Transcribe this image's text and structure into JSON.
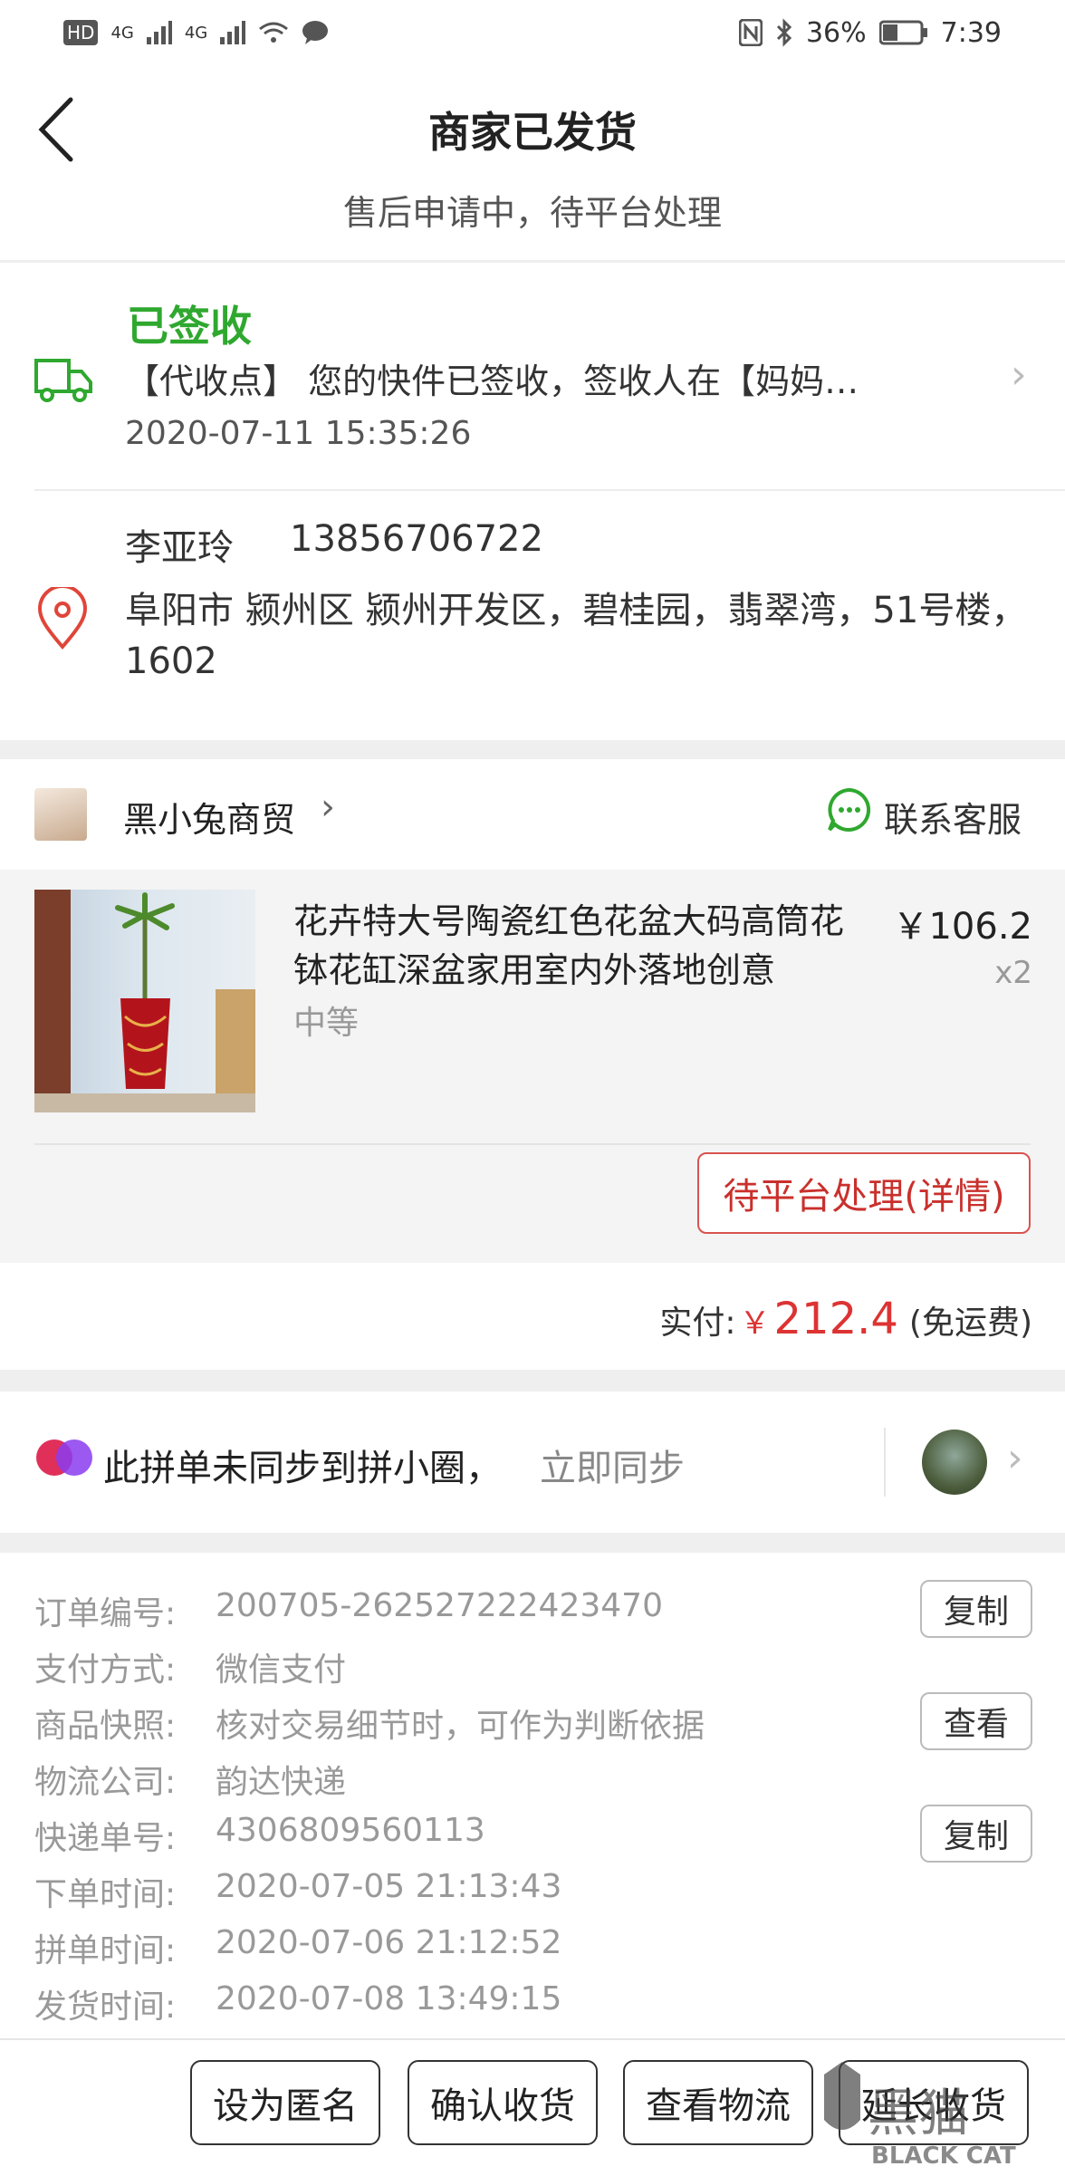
{
  "status_bar": {
    "left": [
      "HD",
      "4G",
      "4G"
    ],
    "battery": "36%",
    "time": "7:39"
  },
  "header": {
    "title": "商家已发货",
    "subtitle": "售后申请中，待平台处理"
  },
  "logistics": {
    "status": "已签收",
    "message": "【代收点】 您的快件已签收，签收人在【妈妈…",
    "time": "2020-07-11 15:35:26"
  },
  "address": {
    "name": "李亚玲",
    "phone": "13856706722",
    "detail": "阜阳市 颍州区 颍州开发区，碧桂园，翡翠湾，51号楼，1602"
  },
  "shop": {
    "name": "黑小兔商贸",
    "contact_label": "联系客服",
    "product": {
      "title": "花卉特大号陶瓷红色花盆大码高筒花钵花缸深盆家用室内外落地创意",
      "spec": "中等",
      "price": "￥106.2",
      "qty": "x2"
    },
    "aftersale_button": "待平台处理(详情)"
  },
  "total": {
    "label": "实付:",
    "currency": "￥",
    "amount": "212.4",
    "note": "(免运费)"
  },
  "sync": {
    "text": "此拼单未同步到拼小圈，",
    "link": "立即同步"
  },
  "order_info": {
    "rows": [
      {
        "label": "订单编号:",
        "value": "200705-262527222423470"
      },
      {
        "label": "支付方式:",
        "value": "微信支付"
      },
      {
        "label": "商品快照:",
        "value": "核对交易细节时，可作为判断依据"
      },
      {
        "label": "物流公司:",
        "value": "韵达快递"
      },
      {
        "label": "快递单号:",
        "value": "4306809560113"
      },
      {
        "label": "下单时间:",
        "value": "2020-07-05 21:13:43"
      },
      {
        "label": "拼单时间:",
        "value": "2020-07-06 21:12:52"
      },
      {
        "label": "发货时间:",
        "value": "2020-07-08 13:49:15"
      }
    ],
    "copy_label": "复制",
    "view_label": "查看"
  },
  "bottom_buttons": [
    "设为匿名",
    "确认收货",
    "查看物流",
    "延长收货"
  ],
  "watermark": {
    "text": "黑猫",
    "sub": "BLACK CAT"
  }
}
